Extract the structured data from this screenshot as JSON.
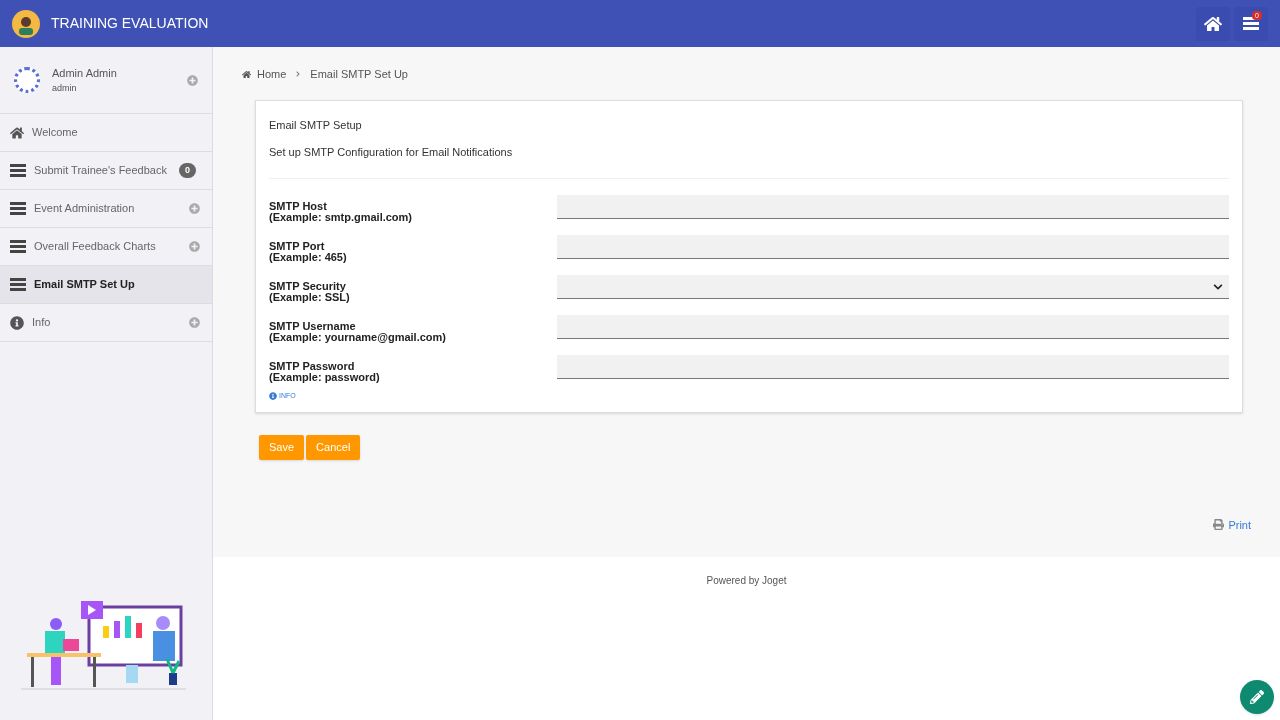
{
  "header": {
    "title": "TRAINING EVALUATION",
    "notification_badge": "0"
  },
  "user": {
    "name": "Admin Admin",
    "username": "admin"
  },
  "sidebar": {
    "items": [
      {
        "label": "Welcome",
        "kind": "home",
        "selected": false
      },
      {
        "label": "Submit Trainee's Feedback",
        "kind": "list",
        "badge": "0",
        "selected": false
      },
      {
        "label": "Event Administration",
        "kind": "list",
        "expandable": true,
        "selected": false
      },
      {
        "label": "Overall Feedback Charts",
        "kind": "list",
        "expandable": true,
        "selected": false
      },
      {
        "label": "Email SMTP Set Up",
        "kind": "list",
        "selected": true
      },
      {
        "label": "Info",
        "kind": "info",
        "expandable": true,
        "selected": false
      }
    ]
  },
  "breadcrumb": [
    "Home",
    "Email SMTP Set Up"
  ],
  "form": {
    "title": "Email SMTP Setup",
    "subtitle": "Set up SMTP Configuration for Email Notifications",
    "fields": [
      {
        "label": "SMTP Host",
        "hint": "(Example: smtp.gmail.com)",
        "kind": "text"
      },
      {
        "label": "SMTP Port",
        "hint": "(Example: 465)",
        "kind": "text"
      },
      {
        "label": "SMTP Security",
        "hint": "(Example: SSL)",
        "kind": "select"
      },
      {
        "label": "SMTP Username",
        "hint": "(Example: yourname@gmail.com)",
        "kind": "text"
      },
      {
        "label": "SMTP Password",
        "hint": "(Example: password)",
        "kind": "password"
      }
    ],
    "info_link": "INFO"
  },
  "buttons": [
    "Save",
    "Cancel"
  ],
  "print_link": "Print",
  "footer": "Powered by Joget"
}
